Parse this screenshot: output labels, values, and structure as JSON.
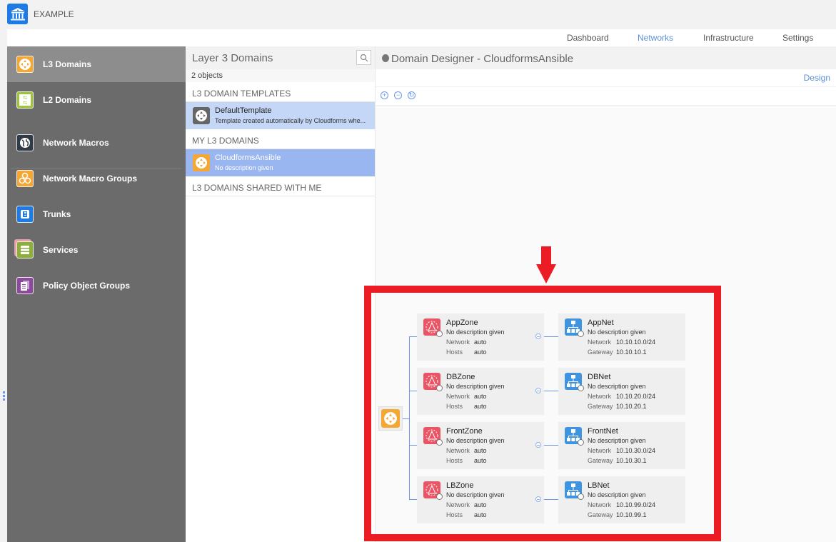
{
  "app": {
    "title": "EXAMPLE",
    "logo_icon": "bank-building-icon"
  },
  "nav": {
    "items": [
      {
        "label": "Dashboard",
        "active": false
      },
      {
        "label": "Networks",
        "active": true
      },
      {
        "label": "Infrastructure",
        "active": false
      },
      {
        "label": "Settings",
        "active": false
      }
    ]
  },
  "sidebar": {
    "items": [
      {
        "label": "L3 Domains",
        "icon": "l3-domain-icon",
        "color": "#f5a733",
        "active": true
      },
      {
        "label": "L2 Domains",
        "icon": "l2-domain-icon",
        "color": "#9ec43c",
        "active": false
      },
      {
        "label": "Network Macros",
        "icon": "globe-icon",
        "color": "#2f3a44",
        "active": false
      },
      {
        "label": "Network Macro Groups",
        "icon": "globe-group-icon",
        "color": "#f5a733",
        "active": false
      },
      {
        "label": "Trunks",
        "icon": "trunk-icon",
        "color": "#1e7be6",
        "active": false
      },
      {
        "label": "Services",
        "icon": "services-icon",
        "color": "#8cae3a",
        "active": false
      },
      {
        "label": "Policy Object Groups",
        "icon": "policy-group-icon",
        "color": "#8b4a9c",
        "active": false
      }
    ]
  },
  "list": {
    "title": "Layer 3 Domains",
    "count": "2 objects",
    "sections": [
      {
        "heading": "L3 DOMAIN TEMPLATES",
        "items": [
          {
            "name": "DefaultTemplate",
            "description": "Template created automatically by Cloudforms whe...",
            "color": "#666666"
          }
        ]
      },
      {
        "heading": "MY L3 DOMAINS",
        "items": [
          {
            "name": "CloudformsAnsible",
            "description": "No description given",
            "color": "#f5a733"
          }
        ]
      },
      {
        "heading": "L3 DOMAINS SHARED WITH ME",
        "items": []
      }
    ]
  },
  "designer": {
    "title": "Domain Designer - CloudformsAnsible",
    "tab": "Design",
    "toolbar": {
      "zoom_in": "+",
      "zoom_out": "−",
      "reset": "↻"
    },
    "zones": [
      {
        "name": "AppZone",
        "description": "No description given",
        "k1": "Network",
        "v1": "auto",
        "k2": "Hosts",
        "v2": "auto"
      },
      {
        "name": "DBZone",
        "description": "No description given",
        "k1": "Network",
        "v1": "auto",
        "k2": "Hosts",
        "v2": "auto"
      },
      {
        "name": "FrontZone",
        "description": "No description given",
        "k1": "Network",
        "v1": "auto",
        "k2": "Hosts",
        "v2": "auto"
      },
      {
        "name": "LBZone",
        "description": "No description given",
        "k1": "Network",
        "v1": "auto",
        "k2": "Hosts",
        "v2": "auto"
      }
    ],
    "subnets": [
      {
        "name": "AppNet",
        "description": "No description given",
        "k1": "Network",
        "v1": "10.10.10.0/24",
        "k2": "Gateway",
        "v2": "10.10.10.1"
      },
      {
        "name": "DBNet",
        "description": "No description given",
        "k1": "Network",
        "v1": "10.10.20.0/24",
        "k2": "Gateway",
        "v2": "10.10.20.1"
      },
      {
        "name": "FrontNet",
        "description": "No description given",
        "k1": "Network",
        "v1": "10.10.30.0/24",
        "k2": "Gateway",
        "v2": "10.10.30.1"
      },
      {
        "name": "LBNet",
        "description": "No description given",
        "k1": "Network",
        "v1": "10.10.99.0/24",
        "k2": "Gateway",
        "v2": "10.10.99.1"
      }
    ]
  },
  "annotation": {
    "color": "#ec1c24"
  }
}
